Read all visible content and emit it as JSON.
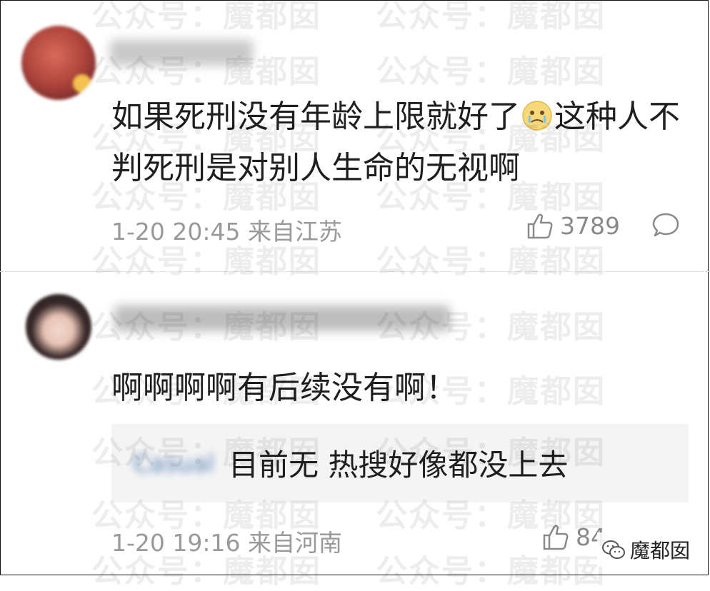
{
  "watermark": "公众号：魔都囡",
  "comments": [
    {
      "text_before_emoji": "如果死刑没有年龄上限就好了",
      "emoji": "crying-face-emoji",
      "text_after_emoji": "这种人不判死刑是对别人生命的无视啊",
      "time_location": "1-20 20:45 来自江苏",
      "likes": "3789"
    },
    {
      "text": "啊啊啊啊有后续没有啊！",
      "time_location": "1-20 19:16 来自河南",
      "likes": "84",
      "reply": {
        "name": "Casual",
        "text": "目前无 热搜好像都没上去"
      }
    }
  ],
  "signature": {
    "icon": "wechat-icon",
    "text": "魔都囡"
  },
  "colors": {
    "text": "#1f1f1f",
    "meta": "#999999",
    "reply_bg": "#f4f4f4",
    "reply_name": "#5b86b8"
  }
}
